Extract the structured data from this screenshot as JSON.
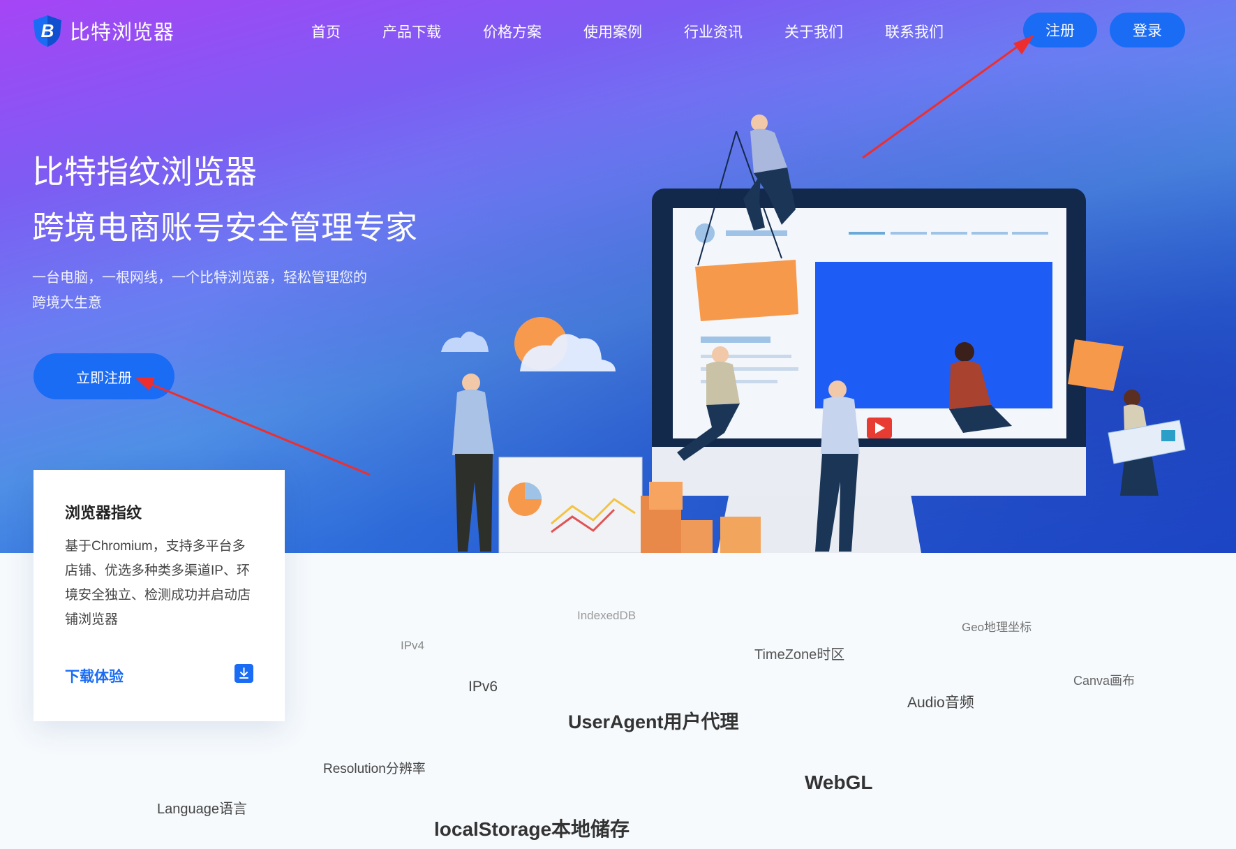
{
  "brand": {
    "name": "比特浏览器",
    "logo_letter": "B",
    "accent": "#1a6cf5"
  },
  "nav": {
    "items": [
      {
        "label": "首页"
      },
      {
        "label": "产品下载"
      },
      {
        "label": "价格方案"
      },
      {
        "label": "使用案例"
      },
      {
        "label": "行业资讯"
      },
      {
        "label": "关于我们"
      },
      {
        "label": "联系我们"
      }
    ],
    "register_label": "注册",
    "login_label": "登录"
  },
  "hero": {
    "title": "比特指纹浏览器",
    "subtitle": "跨境电商账号安全管理专家",
    "description": "一台电脑，一根网线，一个比特浏览器，轻松管理您的跨境大生意",
    "cta_label": "立即注册"
  },
  "feature_card": {
    "title": "浏览器指纹",
    "description": "基于Chromium，支持多平台多店铺、优选多种类多渠道IP、环境安全独立、检测成功并启动店铺浏览器",
    "link_label": "下载体验",
    "icon": "download-icon"
  },
  "tags": [
    {
      "name": "tag-indexeddb",
      "text": "IndexedDB"
    },
    {
      "name": "tag-geo",
      "text": "Geo地理坐标"
    },
    {
      "name": "tag-ipv4",
      "text": "IPv4"
    },
    {
      "name": "tag-timezone",
      "text": "TimeZone时区"
    },
    {
      "name": "tag-canva",
      "text": "Canva画布"
    },
    {
      "name": "tag-ipv6",
      "text": "IPv6"
    },
    {
      "name": "tag-audio",
      "text": "Audio音频"
    },
    {
      "name": "tag-useragent",
      "text": "UserAgent用户代理"
    },
    {
      "name": "tag-resolution",
      "text": "Resolution分辨率"
    },
    {
      "name": "tag-webgl",
      "text": "WebGL"
    },
    {
      "name": "tag-language",
      "text": "Language语言"
    },
    {
      "name": "tag-localstorage",
      "text": "localStorage本地储存"
    }
  ],
  "colors": {
    "annotation_arrow": "#ee2e2e",
    "gradient_start": "#a645f5",
    "gradient_end": "#1e4fcf"
  }
}
